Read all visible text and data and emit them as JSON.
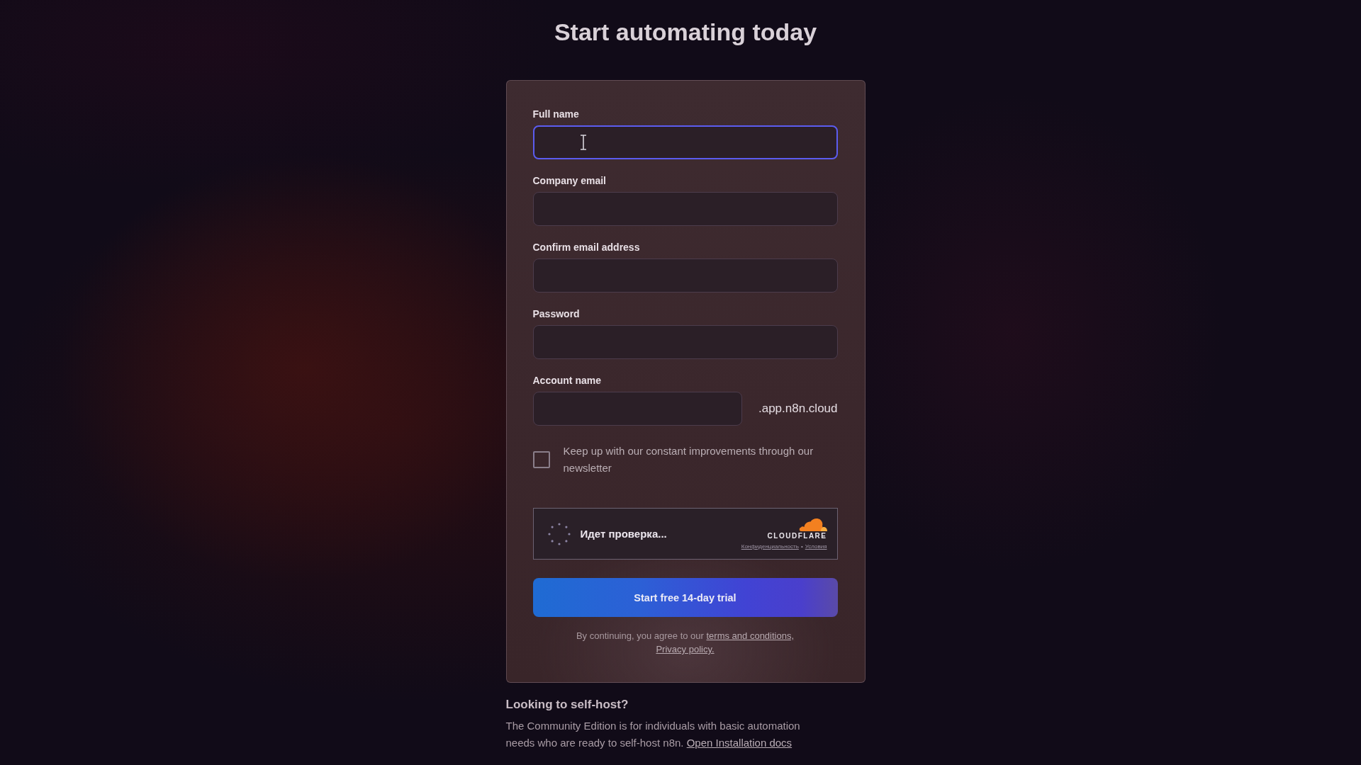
{
  "heading": "Start automating today",
  "form": {
    "fields": [
      {
        "label": "Full name",
        "focused": true
      },
      {
        "label": "Company email",
        "focused": false
      },
      {
        "label": "Confirm email address",
        "focused": false
      },
      {
        "label": "Password",
        "focused": false
      },
      {
        "label": "Account name",
        "focused": false,
        "suffix": ".app.n8n.cloud"
      }
    ],
    "newsletter": {
      "label": "Keep up with our constant improvements through our newsletter",
      "checked": false
    },
    "captcha": {
      "status": "Идет проверка...",
      "brand": "CLOUDFLARE",
      "links": [
        "Конфиденциальность",
        "Условия"
      ],
      "separator": "•"
    },
    "submit": "Start free 14-day trial",
    "legal": {
      "text": "By continuing, you agree to our",
      "links": [
        "terms and conditions,",
        "Privacy policy."
      ]
    }
  },
  "self_host": {
    "title": "Looking to self-host?",
    "text": "The Community Edition is for individuals with basic automation needs who are ready to self-host n8n.",
    "link": "Open Installation docs"
  }
}
